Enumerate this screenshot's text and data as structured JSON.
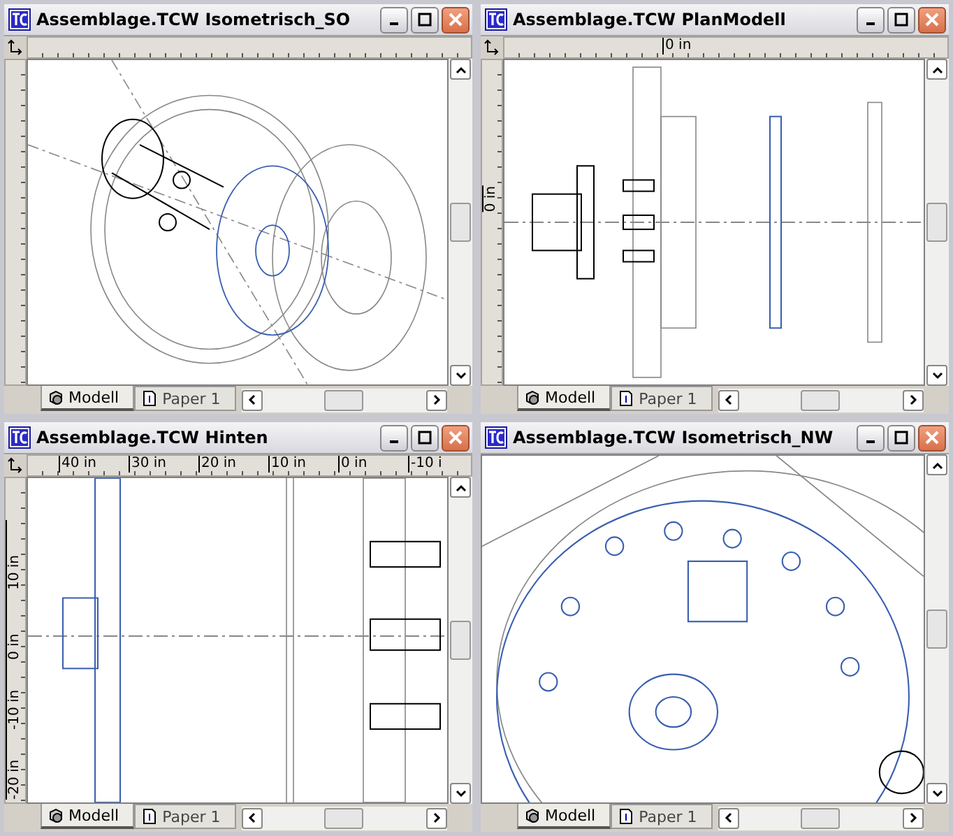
{
  "windows": [
    {
      "title": "Assemblage.TCW Isometrisch_SO",
      "kind": "iso_so",
      "rulers": true,
      "tabs": [
        {
          "label": "Modell",
          "kind": "model",
          "selected": true
        },
        {
          "label": "Paper 1",
          "kind": "paper",
          "selected": false
        }
      ]
    },
    {
      "title": "Assemblage.TCW PlanModell",
      "kind": "plan",
      "rulers": true,
      "top_ruler": [
        "0 in"
      ],
      "left_ruler": [
        "0 in"
      ],
      "tabs": [
        {
          "label": "Modell",
          "kind": "model",
          "selected": true
        },
        {
          "label": "Paper 1",
          "kind": "paper",
          "selected": false
        }
      ]
    },
    {
      "title": "Assemblage.TCW Hinten",
      "kind": "back",
      "rulers": true,
      "top_ruler": [
        "40 in",
        "30 in",
        "20 in",
        "10 in",
        "0 in",
        "-10 i"
      ],
      "left_ruler": [
        "10 in",
        "0 in",
        "-10 in",
        "-20 in"
      ],
      "tabs": [
        {
          "label": "Modell",
          "kind": "model",
          "selected": true
        },
        {
          "label": "Paper 1",
          "kind": "paper",
          "selected": false
        }
      ]
    },
    {
      "title": "Assemblage.TCW Isometrisch_NW",
      "kind": "iso_nw",
      "rulers": false,
      "tabs": [
        {
          "label": "Modell",
          "kind": "model",
          "selected": true
        },
        {
          "label": "Paper 1",
          "kind": "paper",
          "selected": false
        }
      ]
    }
  ]
}
